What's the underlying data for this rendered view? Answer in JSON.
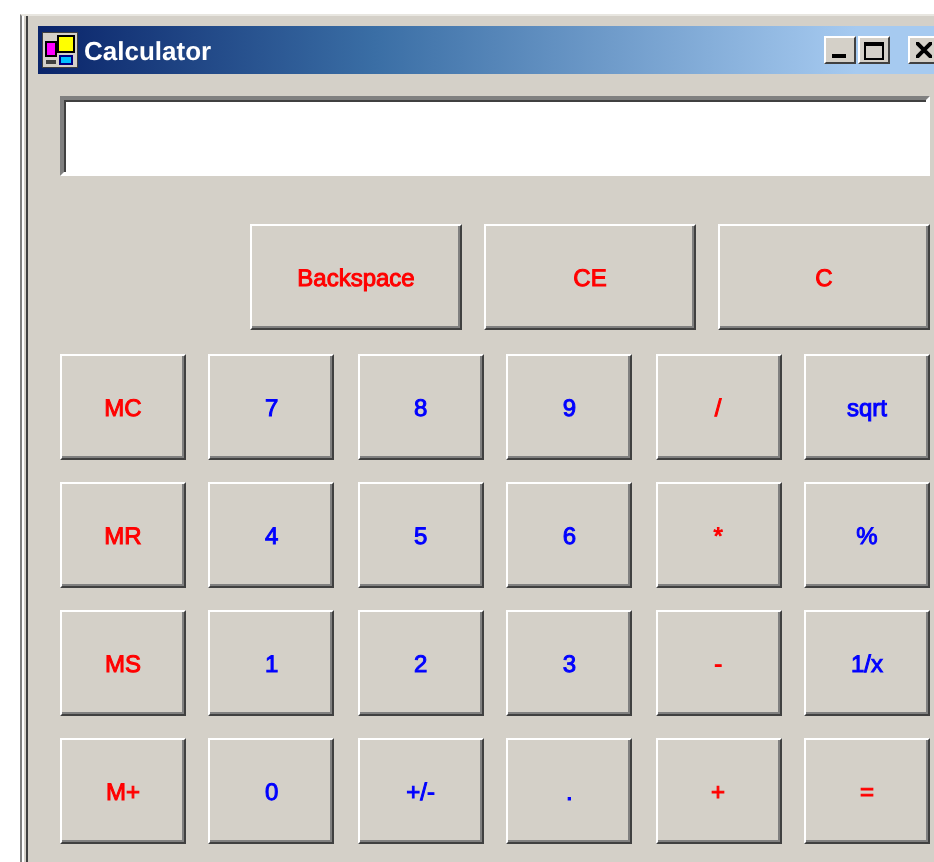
{
  "window": {
    "title": "Calculator"
  },
  "top_buttons": [
    {
      "label": "Backspace",
      "color": "#ff0000"
    },
    {
      "label": "CE",
      "color": "#ff0000"
    },
    {
      "label": "C",
      "color": "#ff0000"
    }
  ],
  "keys": [
    {
      "label": "MC",
      "color": "#ff0000"
    },
    {
      "label": "7",
      "color": "#0000ff"
    },
    {
      "label": "8",
      "color": "#0000ff"
    },
    {
      "label": "9",
      "color": "#0000ff"
    },
    {
      "label": "/",
      "color": "#ff0000"
    },
    {
      "label": "sqrt",
      "color": "#0000ff"
    },
    {
      "label": "MR",
      "color": "#ff0000"
    },
    {
      "label": "4",
      "color": "#0000ff"
    },
    {
      "label": "5",
      "color": "#0000ff"
    },
    {
      "label": "6",
      "color": "#0000ff"
    },
    {
      "label": "*",
      "color": "#ff0000"
    },
    {
      "label": "%",
      "color": "#0000ff"
    },
    {
      "label": "MS",
      "color": "#ff0000"
    },
    {
      "label": "1",
      "color": "#0000ff"
    },
    {
      "label": "2",
      "color": "#0000ff"
    },
    {
      "label": "3",
      "color": "#0000ff"
    },
    {
      "label": "-",
      "color": "#ff0000"
    },
    {
      "label": "1/x",
      "color": "#0000ff"
    },
    {
      "label": "M+",
      "color": "#ff0000"
    },
    {
      "label": "0",
      "color": "#0000ff"
    },
    {
      "label": "+/-",
      "color": "#0000ff"
    },
    {
      "label": ".",
      "color": "#0000ff"
    },
    {
      "label": "+",
      "color": "#ff0000"
    },
    {
      "label": "=",
      "color": "#ff0000"
    }
  ]
}
